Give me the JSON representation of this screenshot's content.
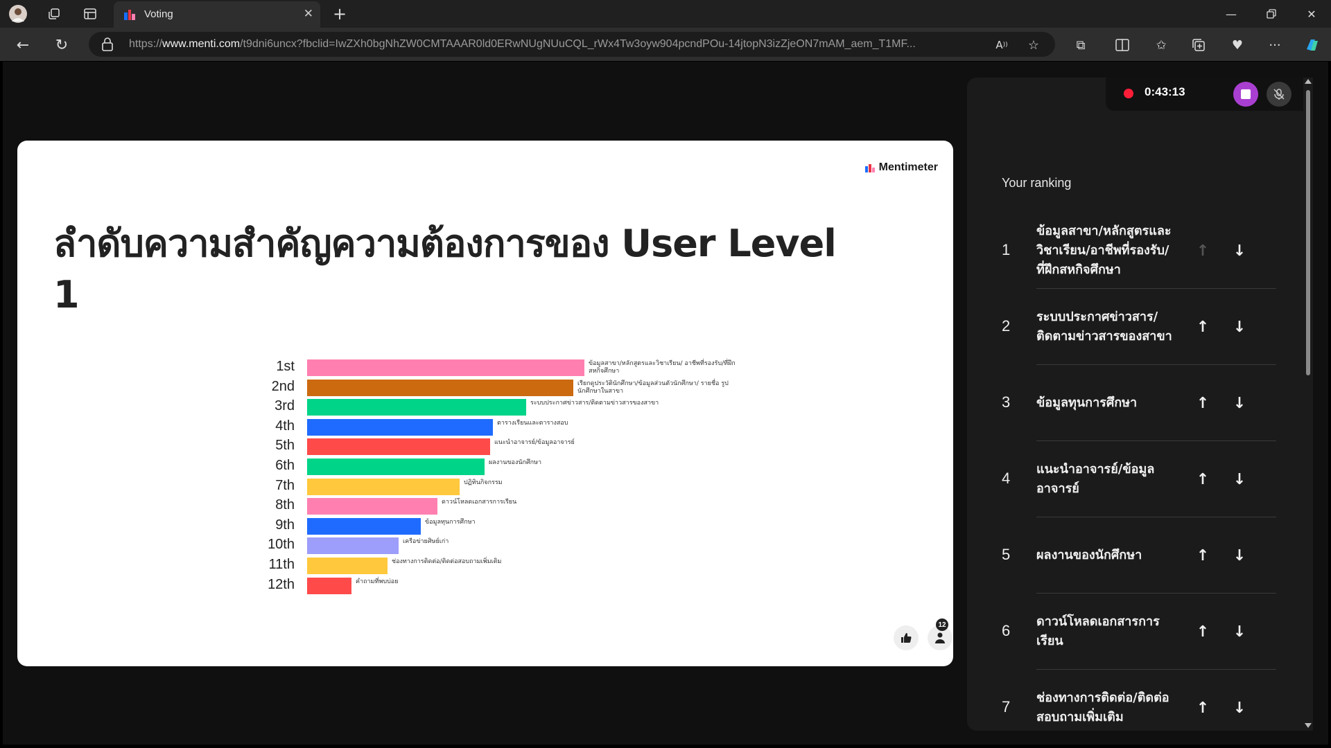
{
  "browser": {
    "tab_title": "Voting",
    "url_prefix": "https://",
    "url_host": "www.menti.com",
    "url_path": "/t9dni6uncx?fbclid=IwZXh0bgNhZW0CMTAAAR0ld0ERwNUgNUuCQL_rWx4Tw3oyw904pcndPOu-14jtopN3izZjeON7mAM_aem_T1MF...",
    "colors": {
      "tab_strip": "#202020",
      "toolbar": "#2e2e2e",
      "menti_red": "#e8364a",
      "menti_blue": "#196cff"
    }
  },
  "slide": {
    "logo_text": "Mentimeter",
    "title": "ลำดับความสำคัญความต้องการของ User Level 1",
    "participant_count": "12"
  },
  "chart_data": {
    "type": "bar",
    "orientation": "horizontal",
    "categories": [
      "1st",
      "2nd",
      "3rd",
      "4th",
      "5th",
      "6th",
      "7th",
      "8th",
      "9th",
      "10th",
      "11th",
      "12th"
    ],
    "labels": [
      "ข้อมูลสาขา/หลักสูตรและวิชาเรียน/ อาชีพที่รองรับ/ที่ฝึกสหกิจศึกษา",
      "เรียกดูประวัตินักศึกษา/ข้อมูลส่วนตัวนักศึกษา/ รายชื่อ รูป นักศึกษาในสาขา",
      "ระบบประกาศข่าวสาร/ติดตามข่าวสารของสาขา",
      "ตารางเรียนและตารางสอบ",
      "แนะนำอาจารย์/ข้อมูลอาจารย์",
      "ผลงานของนักศึกษา",
      "ปฏิทินกิจกรรม",
      "ดาวน์โหลดเอกสารการเรียน",
      "ข้อมูลทุนการศึกษา",
      "เครือข่ายศิษย์เก่า",
      "ช่องทางการติดต่อ/ติดต่อสอบถามเพิ่มเติม",
      "คำถามที่พบบ่อย"
    ],
    "values": [
      100,
      96,
      79,
      67,
      66,
      64,
      55,
      47,
      41,
      33,
      29,
      16
    ],
    "colors": [
      "#ff80b0",
      "#cc6a10",
      "#00d488",
      "#1f6bff",
      "#ff4a4a",
      "#00d488",
      "#ffc83d",
      "#ff80b0",
      "#1f6bff",
      "#9d9dfb",
      "#ffc83d",
      "#ff4a4a"
    ]
  },
  "sidebar": {
    "timer": "0:43:13",
    "heading": "Your ranking",
    "items": [
      {
        "num": "1",
        "line1": "ข้อมูลสาขา/หลักสูตรและ",
        "line2": "วิชาเรียน/อาชีพที่รองรับ/",
        "line3": "ที่ฝึกสหกิจศึกษา",
        "up_disabled": true
      },
      {
        "num": "2",
        "line1": "ระบบประกาศข่าวสาร/",
        "line2": "ติดตามข่าวสารของสาขา",
        "line3": "",
        "up_disabled": false
      },
      {
        "num": "3",
        "line1": "ข้อมูลทุนการศึกษา",
        "line2": "",
        "line3": "",
        "up_disabled": false
      },
      {
        "num": "4",
        "line1": "แนะนำอาจารย์/ข้อมูล",
        "line2": "อาจารย์",
        "line3": "",
        "up_disabled": false
      },
      {
        "num": "5",
        "line1": "ผลงานของนักศึกษา",
        "line2": "",
        "line3": "",
        "up_disabled": false
      },
      {
        "num": "6",
        "line1": "ดาวน์โหลดเอกสารการ",
        "line2": "เรียน",
        "line3": "",
        "up_disabled": false
      },
      {
        "num": "7",
        "line1": "ช่องทางการติดต่อ/ติดต่อ",
        "line2": "สอบถามเพิ่มเติม",
        "line3": "",
        "up_disabled": false
      }
    ]
  }
}
